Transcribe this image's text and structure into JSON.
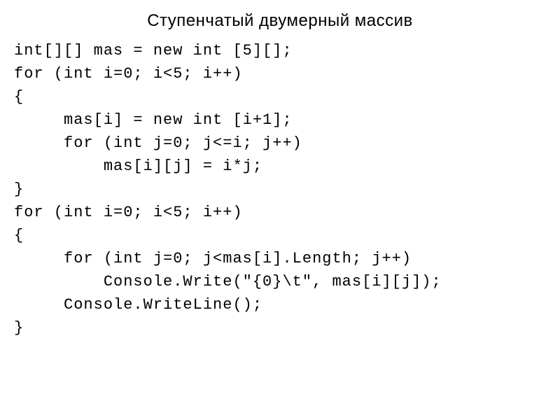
{
  "title": "Ступенчатый двумерный массив",
  "code": {
    "l1": "int[][] mas = new int [5][];",
    "l2": "",
    "l3": "for (int i=0; i<5; i++)",
    "l4": "{",
    "l5": "     mas[i] = new int [i+1];",
    "l6": "     for (int j=0; j<=i; j++)",
    "l7": "         mas[i][j] = i*j;",
    "l8": "}",
    "l9": "for (int i=0; i<5; i++)",
    "l10": "{",
    "l11": "     for (int j=0; j<mas[i].Length; j++)",
    "l12": "         Console.Write(\"{0}\\t\", mas[i][j]);",
    "l13": "     Console.WriteLine();",
    "l14": "}"
  }
}
